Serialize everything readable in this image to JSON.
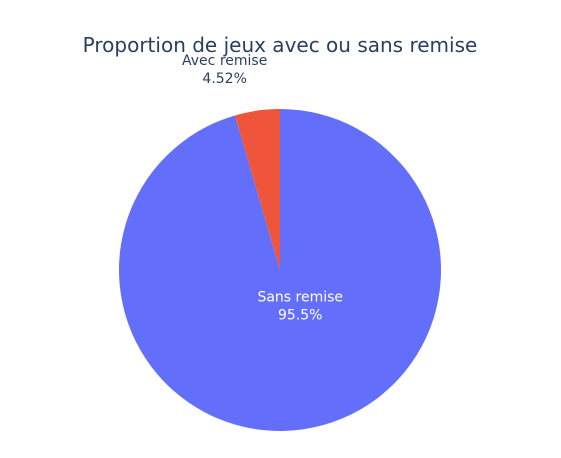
{
  "chart_data": {
    "type": "pie",
    "title": "Proportion de jeux avec ou sans remise",
    "labels": [
      "Avec remise",
      "Sans remise"
    ],
    "values": [
      4.52,
      95.5
    ],
    "percent_labels": [
      "4.52%",
      "95.5%"
    ],
    "colors": [
      "#ef553b",
      "#636efa"
    ],
    "label_colors": [
      "#2a3f5f",
      "#ffffff"
    ],
    "title_color": "#2a3f5f",
    "direction": "clockwise",
    "start_angle": "top"
  }
}
